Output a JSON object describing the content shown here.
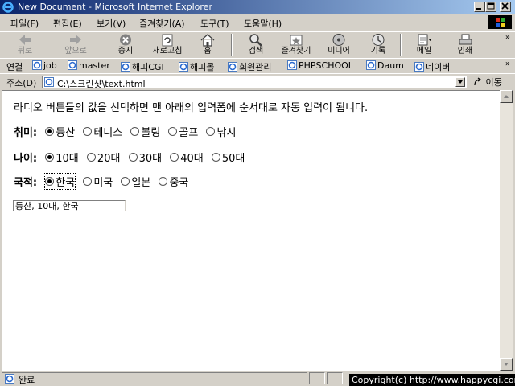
{
  "window": {
    "title": "New Document - Microsoft Internet Explorer"
  },
  "menu": [
    {
      "label": "파일(F)"
    },
    {
      "label": "편집(E)"
    },
    {
      "label": "보기(V)"
    },
    {
      "label": "즐겨찾기(A)"
    },
    {
      "label": "도구(T)"
    },
    {
      "label": "도움말(H)"
    }
  ],
  "toolbar": {
    "back": "뒤로",
    "forward": "앞으로",
    "stop": "중지",
    "refresh": "새로고침",
    "home": "홈",
    "search": "검색",
    "favorites": "즐겨찾기",
    "media": "미디어",
    "history": "기록",
    "mail": "메일",
    "print": "인쇄"
  },
  "links": {
    "label": "연결",
    "items": [
      "job",
      "master",
      "해피CGI",
      "해피몰",
      "회원관리",
      "PHPSCHOOL",
      "Daum",
      "네이버"
    ]
  },
  "address": {
    "label": "주소(D)",
    "value": "C:\\스크린샷\\text.html",
    "go": "이동"
  },
  "page": {
    "intro": "라디오 버튼들의 값을 선택하면 맨 아래의 입력폼에 순서대로 자동 입력이 됩니다.",
    "groups": [
      {
        "label": "취미:",
        "options": [
          "등산",
          "테니스",
          "볼링",
          "골프",
          "낚시"
        ],
        "selected": 0
      },
      {
        "label": "나이:",
        "options": [
          "10대",
          "20대",
          "30대",
          "40대",
          "50대"
        ],
        "selected": 0
      },
      {
        "label": "국적:",
        "options": [
          "한국",
          "미국",
          "일본",
          "중국"
        ],
        "selected": 0
      }
    ],
    "result_value": "등산, 10대, 한국"
  },
  "status": {
    "text": "완료"
  },
  "copyright": "Copyright(c) http://www.happycgi.com"
}
